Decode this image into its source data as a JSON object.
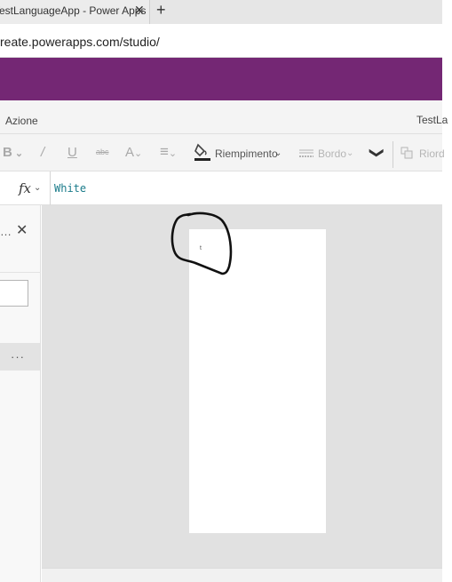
{
  "browser": {
    "tab_title": "TestLanguageApp - Power Apps",
    "tab_close": "✕",
    "new_tab": "+",
    "url": "reate.powerapps.com/studio/"
  },
  "menubar": {
    "azione": "Azione",
    "app_name": "TestLa"
  },
  "toolbar": {
    "bold": "B",
    "italic": "/",
    "underline": "U",
    "strike": "abc",
    "font_size": "A",
    "align": "≡",
    "fill_label": "Riempimento",
    "border_label": "Bordo",
    "more": "❯",
    "reorder_label": "Riord"
  },
  "formula": {
    "fx": "fx",
    "value": "White"
  },
  "left_pane": {
    "ellipsis_top": "…",
    "close": "✕",
    "item_more": "···"
  },
  "canvas": {
    "tiny_control_text": "t"
  }
}
